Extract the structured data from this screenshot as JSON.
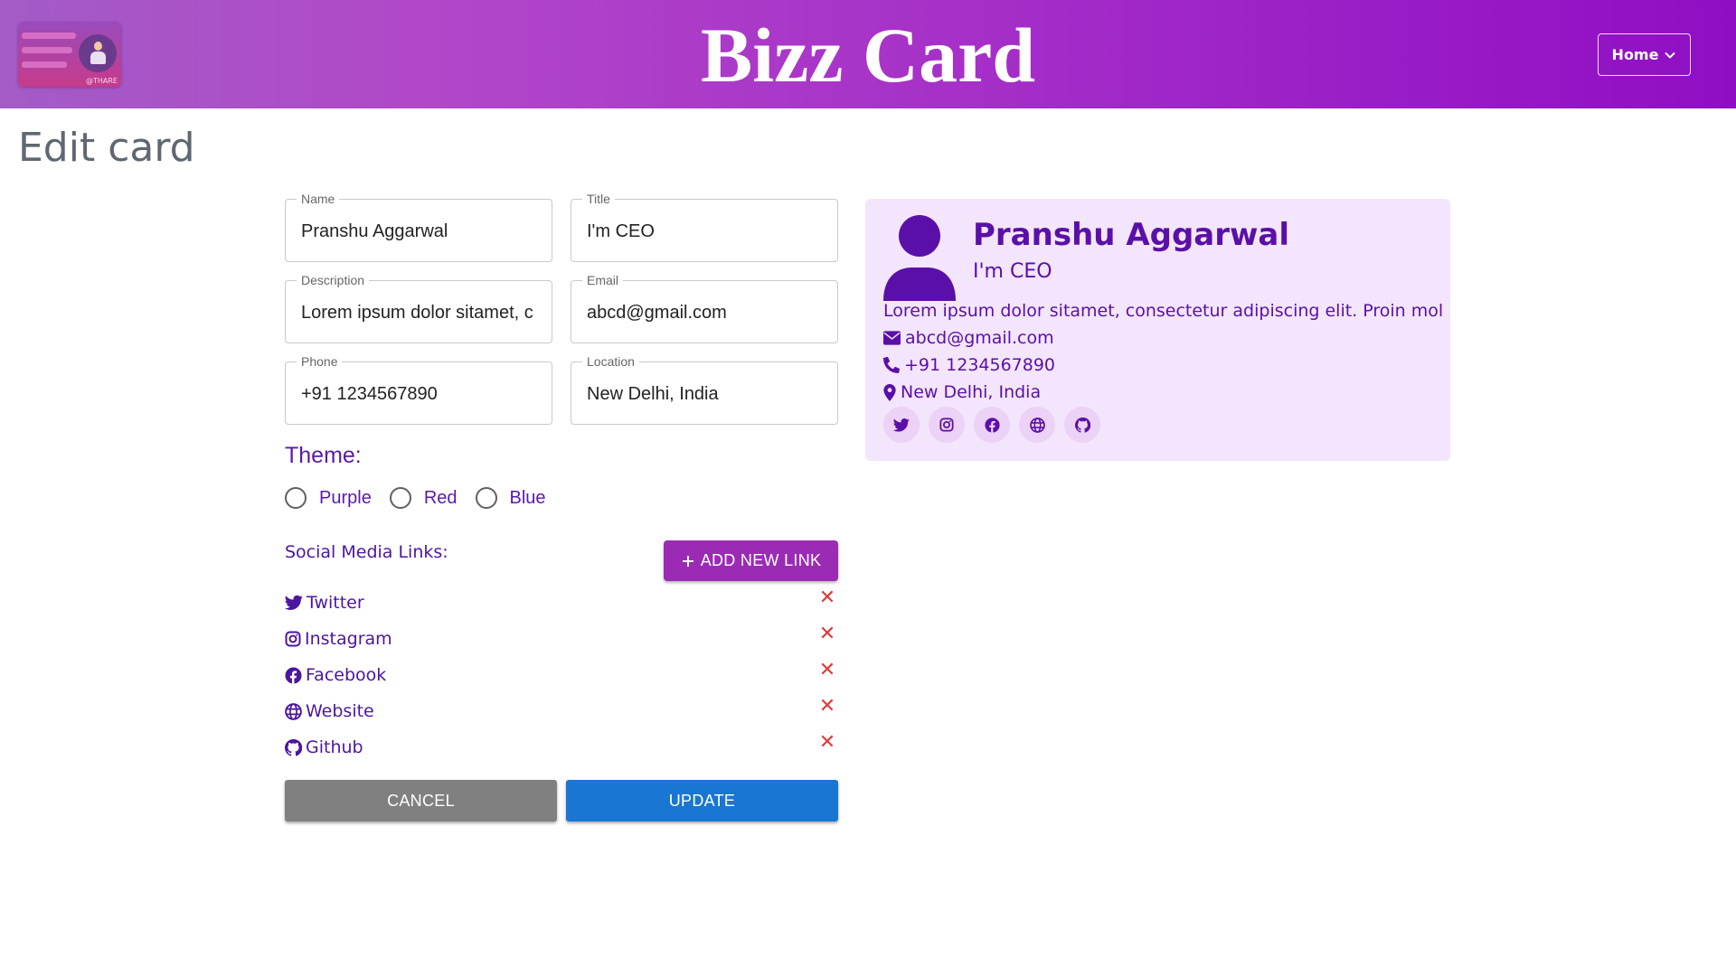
{
  "header": {
    "brand": "Bizz Card",
    "logo_tag": "@THARE",
    "nav_label": "Home"
  },
  "page": {
    "title": "Edit card"
  },
  "form": {
    "fields": {
      "name": {
        "label": "Name",
        "value": "Pranshu Aggarwal"
      },
      "title": {
        "label": "Title",
        "value": "I'm CEO"
      },
      "description": {
        "label": "Description",
        "value": "Lorem ipsum dolor sitamet, c"
      },
      "email": {
        "label": "Email",
        "value": "abcd@gmail.com"
      },
      "phone": {
        "label": "Phone",
        "value": "+91 1234567890"
      },
      "location": {
        "label": "Location",
        "value": "New Delhi, India"
      }
    },
    "theme": {
      "label": "Theme:",
      "options": [
        "Purple",
        "Red",
        "Blue"
      ]
    },
    "social": {
      "title": "Social Media Links:",
      "add_label": "ADD NEW LINK",
      "links": [
        "Twitter",
        "Instagram",
        "Facebook",
        "Website",
        "Github"
      ]
    },
    "cancel_label": "CANCEL",
    "update_label": "UPDATE"
  },
  "card": {
    "name": "Pranshu Aggarwal",
    "title": "I'm CEO",
    "description": "Lorem ipsum dolor sitamet, consectetur adipiscing elit. Proin mollis",
    "email": "abcd@gmail.com",
    "phone": "+91 1234567890",
    "location": "New Delhi, India"
  },
  "colors": {
    "accent": "#5a10a8",
    "add_button": "#9b2bb4",
    "update_button": "#1976d2",
    "cancel_button": "#808080",
    "card_bg": "#f3e5fb",
    "remove": "#e03a3a"
  },
  "icons": [
    "chevron-down-icon",
    "plus-icon",
    "twitter-icon",
    "instagram-icon",
    "facebook-icon",
    "globe-icon",
    "github-icon",
    "close-icon",
    "envelope-icon",
    "phone-icon",
    "map-marker-icon",
    "user-icon"
  ]
}
